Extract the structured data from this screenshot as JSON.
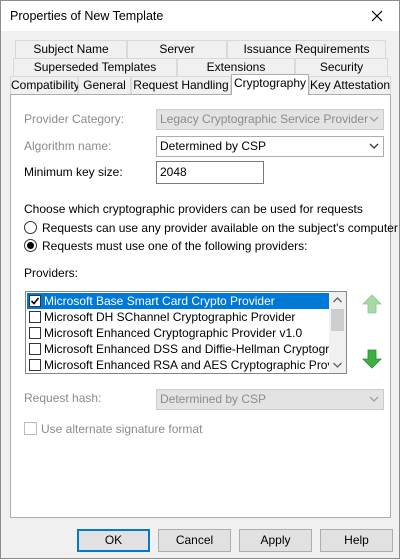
{
  "window": {
    "title": "Properties of New Template"
  },
  "tabs": {
    "row1": [
      "Subject Name",
      "Server",
      "Issuance Requirements"
    ],
    "row2": [
      "Superseded Templates",
      "Extensions",
      "Security"
    ],
    "row3": [
      "Compatibility",
      "General",
      "Request Handling",
      "Cryptography",
      "Key Attestation"
    ],
    "active": "Cryptography"
  },
  "form": {
    "provider_category_label": "Provider Category:",
    "provider_category_value": "Legacy Cryptographic Service Provider",
    "algorithm_label": "Algorithm name:",
    "algorithm_value": "Determined by CSP",
    "min_key_label": "Minimum key size:",
    "min_key_value": "2048",
    "choose_label": "Choose which cryptographic providers can be used for requests",
    "radio_any": "Requests can use any provider available on the subject's computer",
    "radio_following": "Requests must use one of the following providers:",
    "providers_label": "Providers:",
    "providers": [
      {
        "label": "Microsoft Base Smart Card Crypto Provider",
        "checked": true,
        "selected": true
      },
      {
        "label": "Microsoft DH SChannel Cryptographic Provider",
        "checked": false,
        "selected": false
      },
      {
        "label": "Microsoft Enhanced Cryptographic Provider v1.0",
        "checked": false,
        "selected": false
      },
      {
        "label": "Microsoft Enhanced DSS and Diffie-Hellman Cryptographic Pr",
        "checked": false,
        "selected": false
      },
      {
        "label": "Microsoft Enhanced RSA and AES Cryptographic Provider",
        "checked": false,
        "selected": false
      }
    ],
    "request_hash_label": "Request hash:",
    "request_hash_value": "Determined by CSP",
    "alt_signature_label": "Use alternate signature format"
  },
  "buttons": {
    "ok": "OK",
    "cancel": "Cancel",
    "apply": "Apply",
    "help": "Help"
  },
  "colors": {
    "selection": "#0078d7",
    "arrow_green": "#3cb043",
    "arrow_green_disabled": "#a6d8a8"
  }
}
